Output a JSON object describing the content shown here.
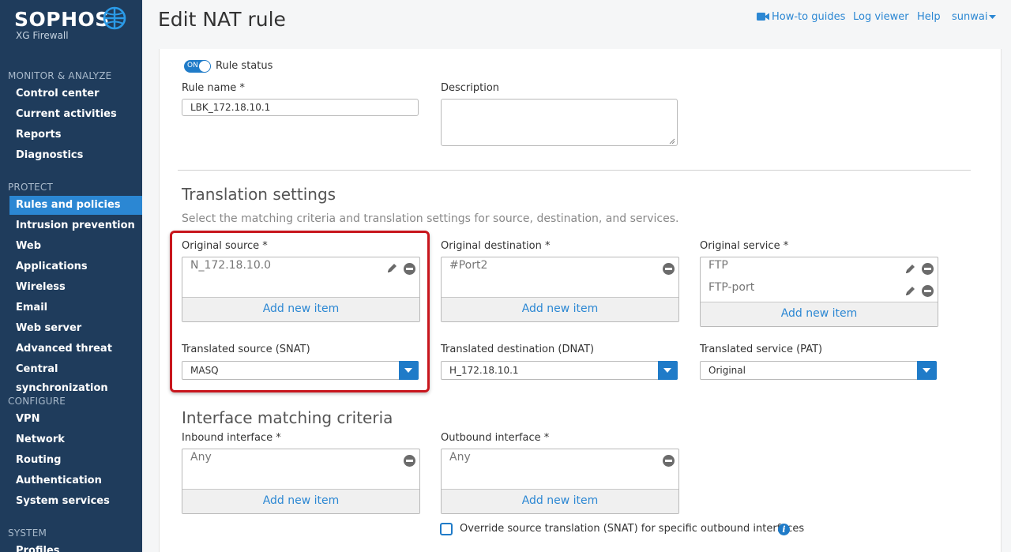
{
  "brand": {
    "name": "SOPHOS",
    "product": "XG Firewall"
  },
  "sidebar": {
    "sections": [
      {
        "label": "MONITOR & ANALYZE",
        "items": [
          "Control center",
          "Current activities",
          "Reports",
          "Diagnostics"
        ]
      },
      {
        "label": "PROTECT",
        "items": [
          "Rules and policies",
          "Intrusion prevention",
          "Web",
          "Applications",
          "Wireless",
          "Email",
          "Web server",
          "Advanced threat",
          "Central synchronization"
        ]
      },
      {
        "label": "CONFIGURE",
        "items": [
          "VPN",
          "Network",
          "Routing",
          "Authentication",
          "System services"
        ]
      },
      {
        "label": "SYSTEM",
        "items": [
          "Profiles"
        ]
      }
    ],
    "active_item": "Rules and policies"
  },
  "header": {
    "title": "Edit NAT rule",
    "howto": "How-to guides",
    "log_viewer": "Log viewer",
    "help": "Help",
    "user": "sunwai"
  },
  "form": {
    "rule_status_toggle": "ON",
    "rule_status_label": "Rule status",
    "rule_name_label": "Rule name *",
    "rule_name_value": "LBK_172.18.10.1",
    "description_label": "Description",
    "description_value": "",
    "translation_title": "Translation settings",
    "translation_hint": "Select the matching criteria and translation settings for source, destination, and services.",
    "orig_source_label": "Original source *",
    "orig_source_items": [
      "N_172.18.10.0"
    ],
    "orig_dest_label": "Original destination *",
    "orig_dest_items": [
      "#Port2"
    ],
    "orig_service_label": "Original service *",
    "orig_service_items": [
      "FTP",
      "FTP-port"
    ],
    "add_new_item": "Add new item",
    "snat_label": "Translated source (SNAT)",
    "snat_value": "MASQ",
    "dnat_label": "Translated destination (DNAT)",
    "dnat_value": "H_172.18.10.1",
    "pat_label": "Translated service (PAT)",
    "pat_value": "Original",
    "interface_title": "Interface matching criteria",
    "inbound_label": "Inbound interface *",
    "inbound_items": [
      "Any"
    ],
    "outbound_label": "Outbound interface *",
    "outbound_items": [
      "Any"
    ],
    "override_label": "Override source translation (SNAT) for specific outbound interfaces",
    "info_glyph": "i"
  },
  "colors": {
    "sidebar": "#1f3c5c",
    "accent": "#2b87d3",
    "highlight": "#c8161d"
  }
}
